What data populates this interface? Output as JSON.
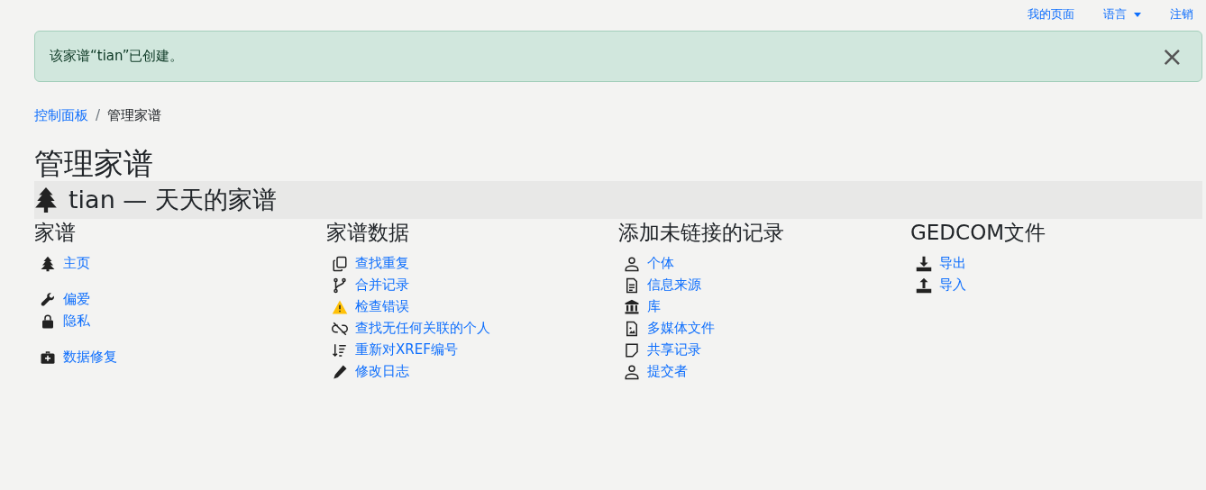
{
  "top_nav": [
    {
      "label": "我的页面",
      "kind": "link"
    },
    {
      "label": "语言",
      "kind": "dropdown"
    },
    {
      "label": "注销",
      "kind": "link"
    }
  ],
  "alert": {
    "message": "该家谱“tian”已创建。",
    "close": "×"
  },
  "breadcrumb": [
    {
      "label": "控制面板",
      "kind": "link"
    },
    {
      "label": "/",
      "kind": "separator"
    },
    {
      "label": "管理家谱",
      "kind": "current"
    }
  ],
  "page_title": "管理家谱",
  "tree_header": "tian — 天天的家谱",
  "sections": [
    {
      "title": "家谱",
      "groups": [
        [
          {
            "label": "主页",
            "kind": "tree"
          }
        ],
        [
          {
            "label": "偏爱",
            "kind": "wrench"
          },
          {
            "label": "隐私",
            "kind": "lock"
          }
        ],
        [
          {
            "label": "数据修复",
            "kind": "medkit"
          }
        ]
      ]
    },
    {
      "title": "家谱数据",
      "groups": [
        [
          {
            "label": "查找重复",
            "kind": "copy"
          },
          {
            "label": "合并记录",
            "kind": "merge"
          },
          {
            "label": "检查错误",
            "kind": "warning"
          },
          {
            "label": "查找无任何关联的个人",
            "kind": "unlink"
          },
          {
            "label": "重新对XREF编号",
            "kind": "sort"
          },
          {
            "label": "修改日志",
            "kind": "pencil"
          }
        ]
      ]
    },
    {
      "title": "添加未链接的记录",
      "groups": [
        [
          {
            "label": "个体",
            "kind": "person"
          },
          {
            "label": "信息来源",
            "kind": "file"
          },
          {
            "label": "库",
            "kind": "bank"
          },
          {
            "label": "多媒体文件",
            "kind": "image"
          },
          {
            "label": "共享记录",
            "kind": "note"
          },
          {
            "label": "提交者",
            "kind": "person"
          }
        ]
      ]
    },
    {
      "title": "GEDCOM文件",
      "groups": [
        [
          {
            "label": "导出",
            "kind": "download"
          },
          {
            "label": "导入",
            "kind": "upload"
          }
        ]
      ]
    }
  ]
}
